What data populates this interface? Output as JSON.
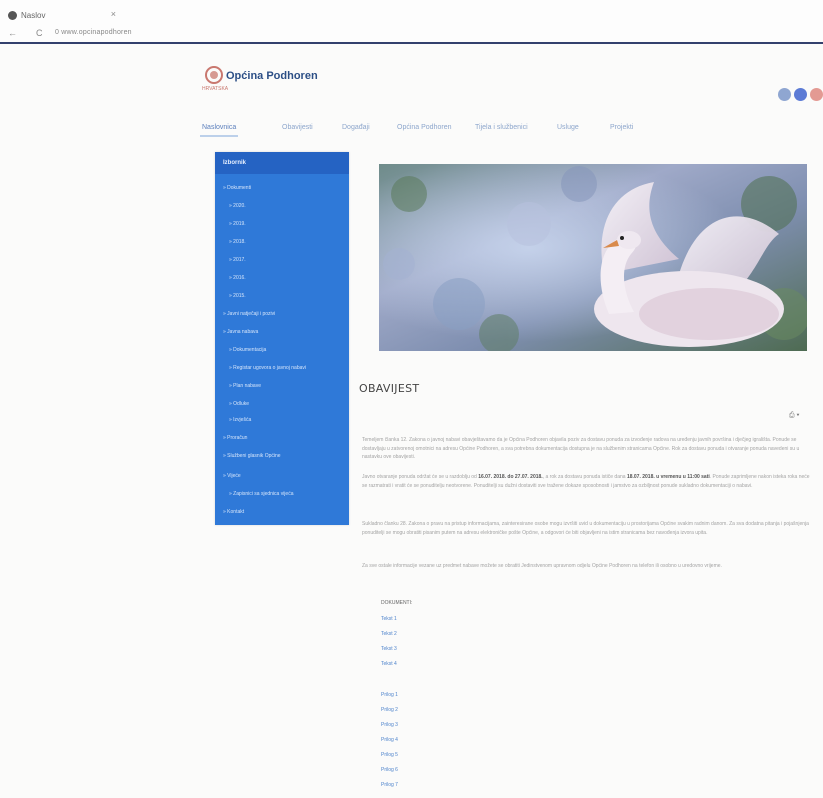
{
  "browser": {
    "tab_title": "Naslov",
    "tab_close": "×",
    "back": "←",
    "reload": "C",
    "url": "0 www.opcinapodhoren"
  },
  "site": {
    "logo_text": "HRVATSKA",
    "title": "Općina Podhoren",
    "social": [
      "facebook-icon",
      "twitter-icon",
      "instagram-icon"
    ]
  },
  "nav": {
    "items": [
      "Naslovnica",
      "Obavijesti",
      "Događaji",
      "Općina Podhoren",
      "Tijela i službenici",
      "Usluge",
      "Projekti"
    ]
  },
  "sidebar": {
    "title": "Izbornik",
    "items": [
      {
        "label": "» Dokumenti",
        "level": 0
      },
      {
        "label": "» 2020.",
        "level": 1
      },
      {
        "label": "» 2019.",
        "level": 1
      },
      {
        "label": "» 2018.",
        "level": 1
      },
      {
        "label": "» 2017.",
        "level": 1
      },
      {
        "label": "» 2016.",
        "level": 1
      },
      {
        "label": "» 2015.",
        "level": 1
      },
      {
        "label": "» Javni natječaji i pozivi",
        "level": 0
      },
      {
        "label": "» Javna nabava",
        "level": 0
      },
      {
        "label": "» Dokumentacija",
        "level": 1
      },
      {
        "label": "» Registar ugovora o javnoj nabavi",
        "level": 1
      },
      {
        "label": "» Plan nabave",
        "level": 1
      },
      {
        "label": "» Odluke",
        "level": 1
      },
      {
        "label": "» Izvješća",
        "level": 1
      },
      {
        "label": "» Proračun",
        "level": 0
      },
      {
        "label": "» Službeni glasnik Općine",
        "level": 0
      },
      {
        "label": "» Vijeće",
        "level": 0
      },
      {
        "label": "» Zapisnici sa sjednica vijeća",
        "level": 1
      },
      {
        "label": "» Kontakt",
        "level": 0
      }
    ]
  },
  "article": {
    "title": "OBAVIJEST",
    "print_icon": "⎙ ▾",
    "p1": "Temeljem članka 12. Zakona o javnoj nabavi obavještavamo da je Općina Podhoren objavila poziv za dostavu ponuda za izvođenje radova na uređenju javnih površina i dječjeg igrališta. Ponude se dostavljaju u zatvorenoj omotnici na adresu Općine Podhoren, a sva potrebna dokumentacija dostupna je na službenim stranicama Općine. Rok za dostavu ponuda i otvaranje ponuda navedeni su u nastavku ove obavijesti.",
    "p2_pre": "Javno otvaranje ponuda održat će se u razdoblju od ",
    "p2_date1": "16.07. 2018. do 27.07. 2018.",
    "p2_mid": ", a rok za dostavu ponuda ističe dana ",
    "p2_date2": "18.07. 2018. u vremenu u 11:00 sati",
    "p2_post": ". Ponude zaprimljene nakon isteka roka neće se razmatrati i vratit će se ponuditelju neotvorene. Ponuditelji su dužni dostaviti sve tražene dokaze sposobnosti i jamstvo za ozbiljnost ponude sukladno dokumentaciji o nabavi.",
    "p3": "Sukladno članku 28. Zakona o pravu na pristup informacijama, zainteresirane osobe mogu izvršiti uvid u dokumentaciju u prostorijama Općine svakim radnim danom. Za sva dodatna pitanja i pojašnjenja ponuditelji se mogu obratiti pisanim putem na adresu elektroničke pošte Općine, a odgovori će biti objavljeni na istim stranicama bez navođenja izvora upita.",
    "p4": "Za sve ostale informacije vezane uz predmet nabave možete se obratiti Jedinstvenom upravnom odjelu Općine Podhoren na telefon ili osobno u uredovno vrijeme.",
    "docs_label": "DOKUMENTI:",
    "docs": [
      "Tekst 1",
      "Tekst 2",
      "Tekst 3",
      "Tekst 4"
    ],
    "links": [
      "Prilog 1",
      "Prilog 2",
      "Prilog 3",
      "Prilog 4",
      "Prilog 5",
      "Prilog 6",
      "Prilog 7"
    ]
  },
  "colors": {
    "sidebar": "#2f79d8",
    "sidebar_head": "#2563c3",
    "title": "#2c4f86",
    "link": "#4f84cc"
  }
}
